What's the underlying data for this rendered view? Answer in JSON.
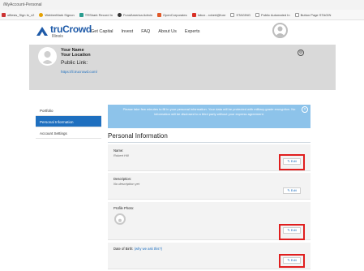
{
  "browser": {
    "url": "/MyAccount-Personal",
    "bookmarks": [
      {
        "label": "ofilesis_Sign In_v2",
        "color": "#c33"
      },
      {
        "label": "WebberMark Signon",
        "color": "#e5a100"
      },
      {
        "label": "TRShark Record In",
        "color": "#2a9d8f"
      },
      {
        "label": "FundAmerica Admin",
        "color": "#333"
      },
      {
        "label": "OpenCorporates",
        "color": "#e05a2a"
      },
      {
        "label": "Inbox - robert@funr",
        "color": "#d93025"
      },
      {
        "label": "STAGING",
        "color": "#bbb"
      },
      {
        "label": "Public Automated In",
        "color": "#bbb"
      },
      {
        "label": "Button Page STAGIN",
        "color": "#bbb"
      }
    ]
  },
  "nav": {
    "logo_text": "truCrowd",
    "logo_sub": "Illinois",
    "links": [
      "Get Capital",
      "Invest",
      "FAQ",
      "About Us",
      "Experts"
    ]
  },
  "profile": {
    "name": "Your Name",
    "location": "Your Location",
    "public_link_label": "Public Link:",
    "public_link_url": "https://il.trucrowd.com/"
  },
  "sidebar": {
    "items": [
      {
        "label": "Portfolio",
        "active": false
      },
      {
        "label": "Personal Information",
        "active": true
      },
      {
        "label": "Account Settings",
        "active": false
      }
    ]
  },
  "banner": {
    "text": "Please take few minutes to fill in your personal information. Your data will be protected with military-grade encryption. No information will be disclosed to a third party without your express agreement.",
    "close_icon": "x"
  },
  "main": {
    "title": "Personal Information",
    "fields": [
      {
        "label": "Name:",
        "value": "Robert Hill",
        "why": "",
        "edit_label": "Edit"
      },
      {
        "label": "Description:",
        "value": "No description yet",
        "why": "",
        "edit_label": "Edit"
      },
      {
        "label": "Profile Photo:",
        "value": "",
        "why": "",
        "edit_label": "Edit"
      },
      {
        "label": "Date of Birth:",
        "value": "",
        "why": "(why we ask this?)",
        "edit_label": "Edit"
      }
    ]
  },
  "colors": {
    "brand_blue": "#1e6fbf",
    "banner_blue": "#8dc3ea",
    "highlight_red": "#e01e1e"
  }
}
